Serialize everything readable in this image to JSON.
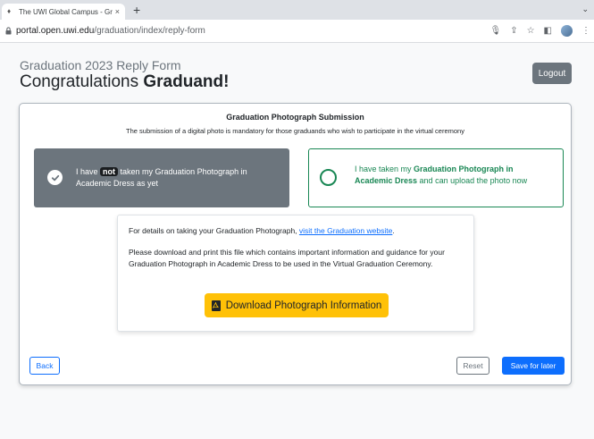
{
  "browser": {
    "tab_title": "The UWI Global Campus - Grad",
    "tab_close": "×",
    "new_tab": "+",
    "tab_menu": "⌄",
    "url_host": "portal.open.uwi.edu",
    "url_path": "/graduation/index/reply-form"
  },
  "header": {
    "subtitle": "Graduation 2023 Reply Form",
    "title_prefix": "Congratulations ",
    "title_bold": "Graduand!",
    "logout_label": "Logout"
  },
  "card": {
    "heading": "Graduation Photograph Submission",
    "subheading": "The submission of a digital photo is mandatory for those graduands who wish to participate in the virtual ceremony",
    "option_not_taken": {
      "text_before": "I have ",
      "badge": "not",
      "text_after": " taken my Graduation Photograph in Academic Dress as yet",
      "selected": true
    },
    "option_taken": {
      "text_before": "I have taken my ",
      "bold": "Graduation Photograph in Academic Dress",
      "text_after": " and can upload the photo now",
      "selected": false
    },
    "info": {
      "p1_before": "For details on taking your Graduation Photograph, ",
      "p1_link": "visit the Graduation website",
      "p1_after": ".",
      "p2": "Please download and print this file which contains important information and guidance for your Graduation Photograph in Academic Dress to be used in the Virtual Graduation Ceremony.",
      "download_label": "Download Photograph Information"
    },
    "back_label": "Back",
    "reset_label": "Reset",
    "save_label": "Save for later"
  },
  "icons": {
    "lock": "lock-icon",
    "pdf": "pdf-file-icon",
    "check": "check-circle-icon"
  },
  "colors": {
    "primary": "#0d6efd",
    "success": "#198754",
    "secondary": "#6c757d",
    "warning": "#ffc107"
  }
}
